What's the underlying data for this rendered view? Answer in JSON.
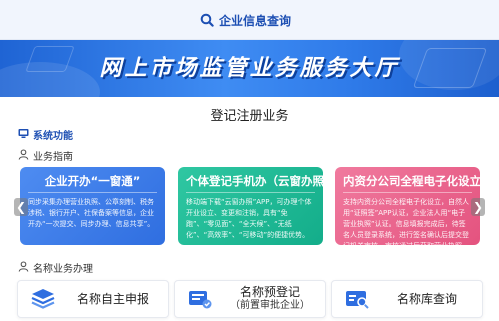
{
  "header": {
    "search_link": "企业信息查询"
  },
  "banner": {
    "title": "网上市场监管业务服务大厅"
  },
  "main": {
    "section_title": "登记注册业务",
    "features_heading": "系统功能",
    "guide_heading": "业务指南",
    "cards": [
      {
        "title": "企业开办“一窗通”",
        "desc": "同步采集办理营业执照、公章刻制、税务涉税、银行开户、社保备案等信息，企业开办“一次提交、同步办理、信息共享”。"
      },
      {
        "title": "个体登记手机办（云窗办照）",
        "desc": "移动端下载“云窗办照”APP，可办理个体开业设立、变更和注销，具有“免跑”、“零见面”、“全天候”、“无纸化”、“高效率”、“可移动”的便捷优势。"
      },
      {
        "title": "内资分公司全程电子化设立",
        "desc": "支持内资分公司全程电子化设立，自然人用“证照签”APP认证，企业法人用“电子营业执照”认证。信息填报完成后，待签名人员登录系统，进行签名确认后提交登记机关审核，审核通过后获取营业执照。"
      }
    ],
    "name_heading": "名称业务办理",
    "services": [
      {
        "label": "名称自主申报",
        "sub": ""
      },
      {
        "label": "名称预登记",
        "sub": "（前置审批企业）"
      },
      {
        "label": "名称库查询",
        "sub": ""
      }
    ]
  },
  "colors": {
    "primary": "#1d4fb3",
    "banner": "#2f7be9",
    "card_blue": "#2f6ee0",
    "card_green": "#13ad8a",
    "card_pink": "#e4537f"
  },
  "icons": [
    "search-icon",
    "monitor-icon",
    "user-icon",
    "user-icon",
    "layers-icon",
    "car-icon",
    "id-card-icon",
    "chevron-left-icon",
    "chevron-right-icon"
  ]
}
